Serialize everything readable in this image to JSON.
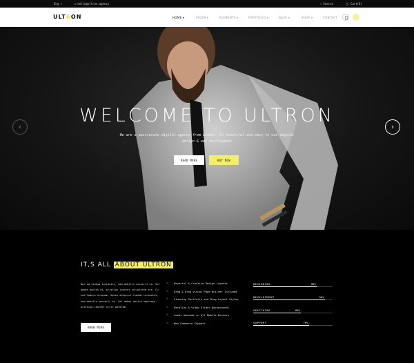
{
  "topbar": {
    "language": "Eng",
    "email": "hello@ultron.agency",
    "search_label": "Search",
    "cart_label": "Cart(0)"
  },
  "header": {
    "logo_prefix": "ULT",
    "logo_accent": "R",
    "logo_suffix": "ON",
    "nav": [
      {
        "label": "HOME ▾",
        "active": true
      },
      {
        "label": "PAGES ▾",
        "active": false
      },
      {
        "label": "ELEMENTS ▾",
        "active": false
      },
      {
        "label": "PORTFOLIO ▾",
        "active": false
      },
      {
        "label": "BLOG ▾",
        "active": false
      },
      {
        "label": "SHOP ▾",
        "active": false
      },
      {
        "label": "CONTACT",
        "active": false
      }
    ]
  },
  "hero": {
    "title": "WELCOME TO ULTRON",
    "subtitle": "We are a passionate digital agency from London. Do beautiful and easy-to-use digital design & web development",
    "read_more": "READ MORE",
    "buy_now": "BUY NOW",
    "prev_arrow": "‹",
    "next_arrow": "›"
  },
  "about": {
    "title_prefix": "IT,S ALL ",
    "title_highlight": "ABOUT ULTRON",
    "paragraph": "Nec ad timeam tacimates, eam debitis senserit ea. Vel debet doctus ei, pristion laoreet scriptorem ete. Cu sed homero aliquam. Omnes adipisci timeam tacimates, eam debitis senserit ea. Vel debet doctus umplease, pristium laoreet scrit optorem.",
    "know_more": "KNOW MORE",
    "features": [
      "Powerful & Creative Design Layouts",
      "Drag & Drop Visual Page Builder Included",
      "Stunning Portfolio and Blog Layout Styles",
      "Parallax & Video Slider Backgrounds",
      "Looks Awesome in All Mobile Devices",
      "Woo Commerce Support"
    ],
    "skills": [
      {
        "name": "DESIGNING",
        "percent_label": "80%",
        "value": 80
      },
      {
        "name": "DEVELOPMENT",
        "percent_label": "90%",
        "value": 90
      },
      {
        "name": "SKECTHING",
        "percent_label": "60%",
        "value": 60
      },
      {
        "name": "SUPPORT",
        "percent_label": "70%",
        "value": 70
      }
    ]
  },
  "colors": {
    "accent": "#f4ef6b",
    "background": "#000000"
  }
}
